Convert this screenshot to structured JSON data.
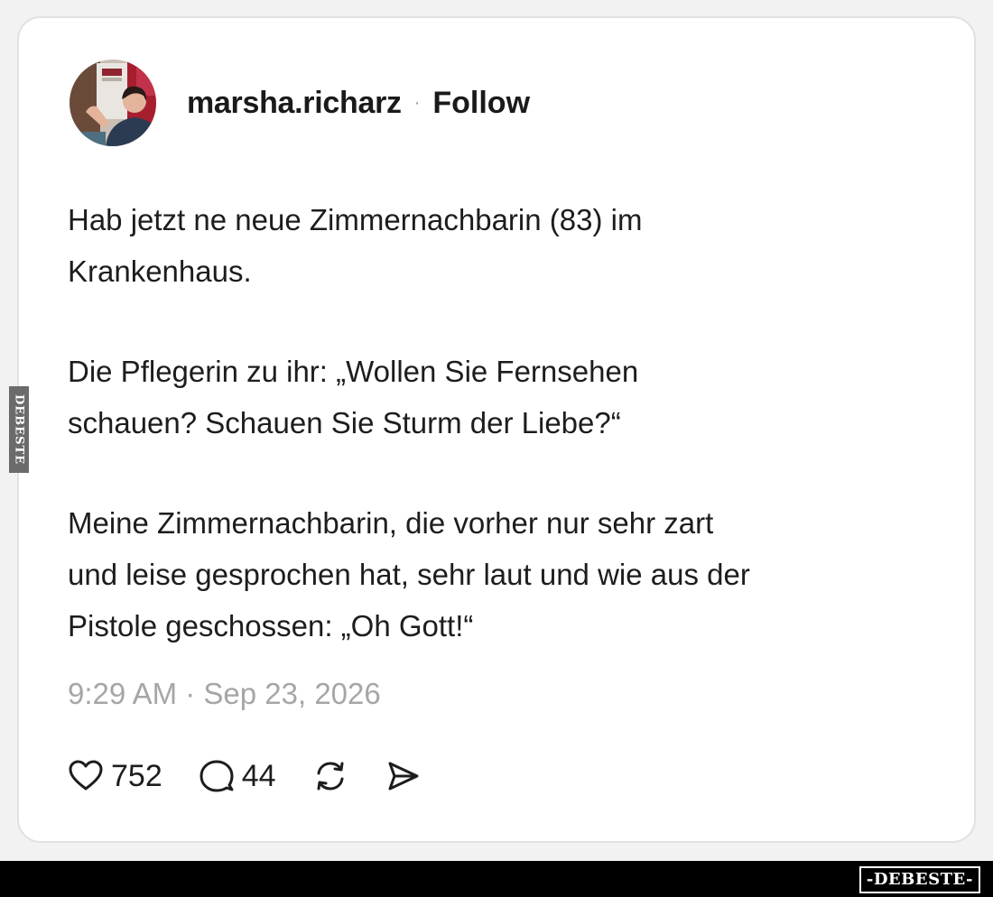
{
  "post": {
    "username": "marsha.richarz",
    "separator": "·",
    "follow_label": "Follow",
    "paragraphs": [
      "Hab jetzt ne neue Zimmernachbarin (83) im\nKrankenhaus.",
      "Die Pflegerin zu ihr: „Wollen Sie Fernsehen\nschauen? Schauen Sie Sturm der Liebe?“",
      "Meine Zimmernachbarin, die vorher nur sehr zart\nund leise gesprochen hat, sehr laut und wie aus der\nPistole geschossen: „Oh Gott!“"
    ],
    "timestamp": "9:29 AM · Sep 23, 2026"
  },
  "actions": {
    "like_count": "752",
    "reply_count": "44",
    "like_icon": "heart-icon",
    "reply_icon": "speech-bubble-icon",
    "repost_icon": "repost-icon",
    "share_icon": "send-icon"
  },
  "watermark": {
    "side_text": "DEBESTE",
    "logo_text": "-DEBESTE-"
  },
  "colors": {
    "page_background": "#f2f2f2",
    "card_background": "#ffffff",
    "text": "#1d1d1d",
    "muted_text": "#a6a6a6",
    "footer_bar": "#000000"
  }
}
